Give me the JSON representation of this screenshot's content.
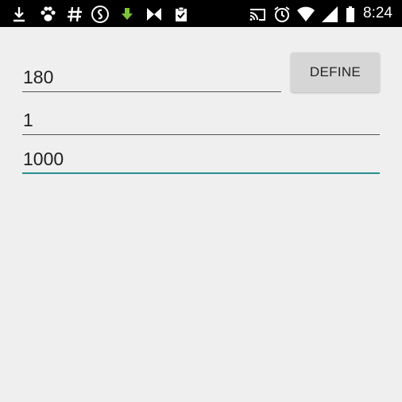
{
  "status_bar": {
    "time": "8:24",
    "left_icons": [
      "download-icon",
      "paw-icon",
      "hash-icon",
      "shazam-icon",
      "green-download-icon",
      "bowtie-icon",
      "clipboard-check-icon"
    ],
    "right_icons": [
      "cast-icon",
      "alarm-icon",
      "wifi-icon",
      "signal-icon",
      "battery-icon"
    ]
  },
  "form": {
    "field1_value": "180",
    "field2_value": "1",
    "field3_value": "1000",
    "define_label": "DEFINE"
  },
  "colors": {
    "background": "#efefef",
    "accent": "#2a8f8f",
    "button": "#d6d6d6"
  }
}
